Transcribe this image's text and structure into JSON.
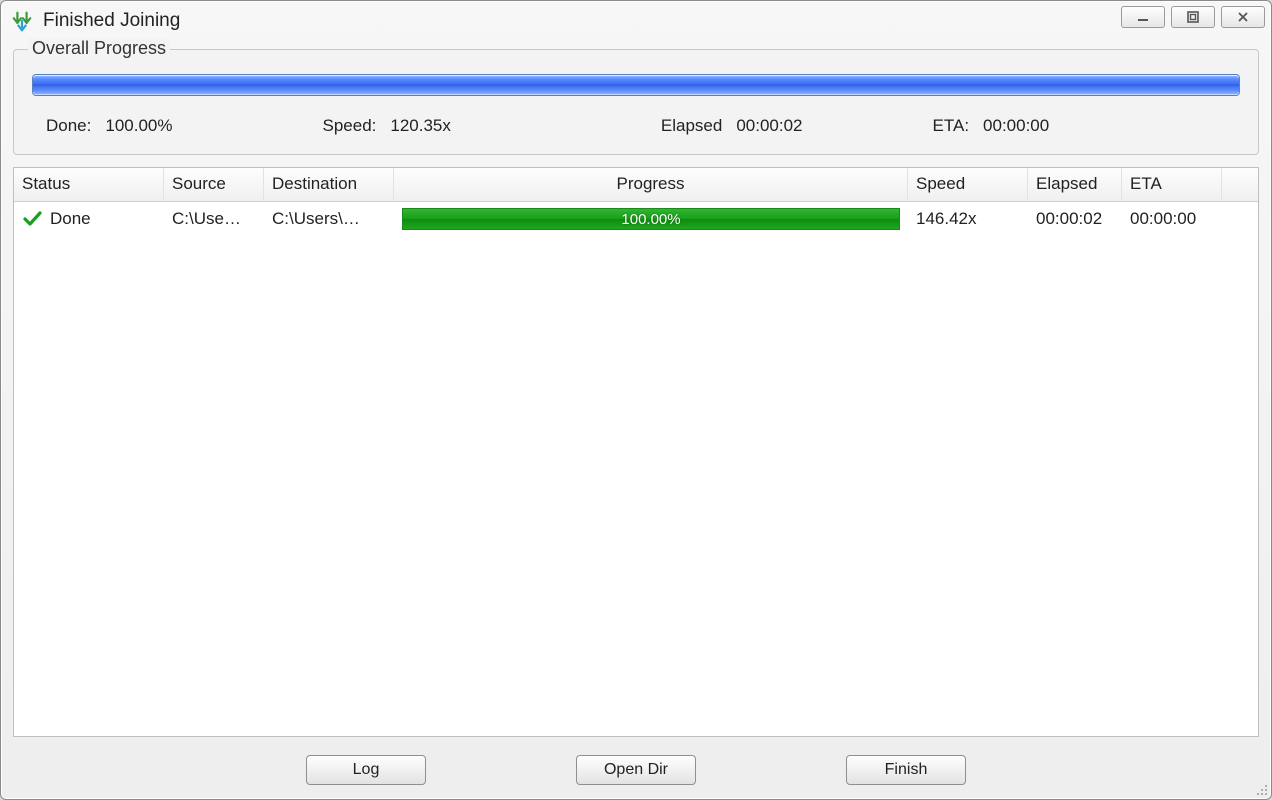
{
  "window": {
    "title": "Finished Joining"
  },
  "overall": {
    "legend": "Overall Progress",
    "progress_percent": 100,
    "done_label": "Done:",
    "done_value": "100.00%",
    "speed_label": "Speed:",
    "speed_value": "120.35x",
    "elapsed_label": "Elapsed",
    "elapsed_value": "00:00:02",
    "eta_label": "ETA:",
    "eta_value": "00:00:00"
  },
  "table": {
    "headers": {
      "status": "Status",
      "source": "Source",
      "destination": "Destination",
      "progress": "Progress",
      "speed": "Speed",
      "elapsed": "Elapsed",
      "eta": "ETA"
    },
    "rows": [
      {
        "status": "Done",
        "source": "C:\\Use…",
        "destination": "C:\\Users\\…",
        "progress_text": "100.00%",
        "progress_percent": 100,
        "speed": "146.42x",
        "elapsed": "00:00:02",
        "eta": "00:00:00"
      }
    ]
  },
  "buttons": {
    "log": "Log",
    "open_dir": "Open Dir",
    "finish": "Finish"
  }
}
